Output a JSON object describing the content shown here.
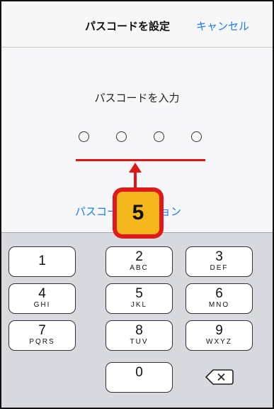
{
  "nav": {
    "title": "パスコードを設定",
    "cancel_label": "キャンセル"
  },
  "main": {
    "prompt": "パスコードを入力",
    "options_link": "パスコードオプション",
    "passcode_length": 4,
    "entered_digits": 0
  },
  "annotation": {
    "step_number": "5",
    "color": "#e01515",
    "badge_fill": "#f5b81c"
  },
  "keypad": {
    "keys": [
      {
        "digit": "1",
        "letters": ""
      },
      {
        "digit": "2",
        "letters": "ABC"
      },
      {
        "digit": "3",
        "letters": "DEF"
      },
      {
        "digit": "4",
        "letters": "GHI"
      },
      {
        "digit": "5",
        "letters": "JKL"
      },
      {
        "digit": "6",
        "letters": "MNO"
      },
      {
        "digit": "7",
        "letters": "PQRS"
      },
      {
        "digit": "8",
        "letters": "TUV"
      },
      {
        "digit": "9",
        "letters": "WXYZ"
      },
      {
        "digit": "0",
        "letters": ""
      }
    ],
    "delete_icon": "delete-backward-icon"
  },
  "colors": {
    "link_blue": "#1a7cf5",
    "keyboard_bg": "#d7d9de"
  }
}
